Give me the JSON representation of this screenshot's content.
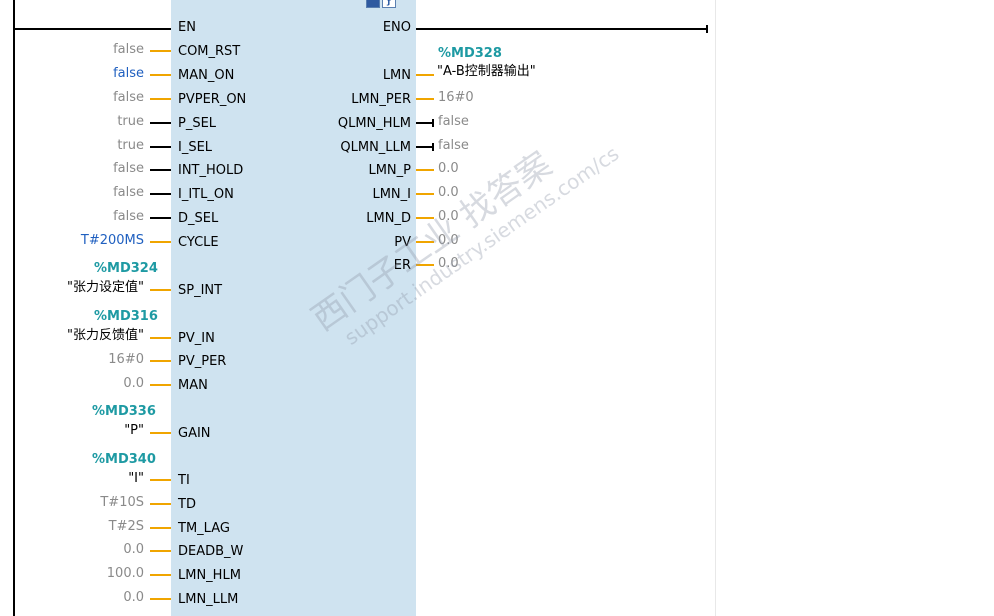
{
  "block": {
    "header_icons": [
      "display-icon",
      "settings-icon"
    ],
    "en": "EN",
    "eno": "ENO"
  },
  "inputs": [
    {
      "pin": "COM_RST",
      "value": "false"
    },
    {
      "pin": "MAN_ON",
      "value": "false"
    },
    {
      "pin": "PVPER_ON",
      "value": "false"
    },
    {
      "pin": "P_SEL",
      "value": "true"
    },
    {
      "pin": "I_SEL",
      "value": "true"
    },
    {
      "pin": "INT_HOLD",
      "value": "false"
    },
    {
      "pin": "I_ITL_ON",
      "value": "false"
    },
    {
      "pin": "D_SEL",
      "value": "false"
    },
    {
      "pin": "CYCLE",
      "value": "T#200MS"
    },
    {
      "pin": "SP_INT",
      "address": "%MD324",
      "value": "\"张力设定值\""
    },
    {
      "pin": "PV_IN",
      "address": "%MD316",
      "value": "\"张力反馈值\""
    },
    {
      "pin": "PV_PER",
      "value": "16#0"
    },
    {
      "pin": "MAN",
      "value": "0.0"
    },
    {
      "pin": "GAIN",
      "address": "%MD336",
      "value": "\"P\""
    },
    {
      "pin": "TI",
      "address": "%MD340",
      "value": "\"I\""
    },
    {
      "pin": "TD",
      "value": "T#10S"
    },
    {
      "pin": "TM_LAG",
      "value": "T#2S"
    },
    {
      "pin": "DEADB_W",
      "value": "0.0"
    },
    {
      "pin": "LMN_HLM",
      "value": "100.0"
    },
    {
      "pin": "LMN_LLM",
      "value": "0.0"
    }
  ],
  "outputs": [
    {
      "pin": "LMN",
      "address": "%MD328",
      "value": "\"A-B控制器输出\""
    },
    {
      "pin": "LMN_PER",
      "value": "16#0"
    },
    {
      "pin": "QLMN_HLM",
      "value": "false"
    },
    {
      "pin": "QLMN_LLM",
      "value": "false"
    },
    {
      "pin": "LMN_P",
      "value": "0.0"
    },
    {
      "pin": "LMN_I",
      "value": "0.0"
    },
    {
      "pin": "LMN_D",
      "value": "0.0"
    },
    {
      "pin": "PV",
      "value": "0.0"
    },
    {
      "pin": "ER",
      "value": "0.0"
    }
  ],
  "watermark": {
    "line1": "西门子工业 找答案",
    "line2": "support.industry.siemens.com/cs"
  },
  "colors": {
    "block_fill": "#cfe3f0",
    "wire_orange": "#f0a500",
    "address_teal": "#1e9aa3",
    "value_blue": "#2060c0",
    "value_gray": "#8a8a8a"
  }
}
